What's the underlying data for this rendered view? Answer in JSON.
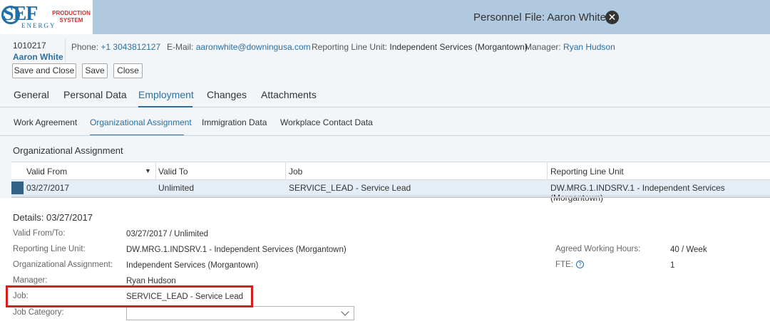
{
  "logo": {
    "name": "SEF",
    "sub": "ENERGY",
    "system": "PRODUCTION SYSTEM"
  },
  "window": {
    "title": "Personnel File: Aaron White"
  },
  "employee": {
    "id": "1010217",
    "name": "Aaron White",
    "phone_label": "Phone:",
    "phone": "+1 3043812127",
    "email_label": "E-Mail:",
    "email": "aaronwhite@downingusa.com",
    "rlu_label": "Reporting Line Unit:",
    "rlu": "Independent Services (Morgantown)",
    "manager_label": "Manager:",
    "manager": "Ryan Hudson"
  },
  "actions": {
    "save_close": "Save and Close",
    "save": "Save",
    "close": "Close"
  },
  "tabs": [
    "General",
    "Personal Data",
    "Employment",
    "Changes",
    "Attachments"
  ],
  "active_tab": "Employment",
  "subtabs": [
    "Work Agreement",
    "Organizational Assignment",
    "Immigration Data",
    "Workplace Contact Data"
  ],
  "active_subtab": "Organizational Assignment",
  "section": {
    "title": "Organizational Assignment",
    "columns": [
      "Valid From",
      "Valid To",
      "Job",
      "Reporting Line Unit"
    ],
    "rows": [
      [
        "03/27/2017",
        "Unlimited",
        "SERVICE_LEAD - Service Lead",
        "DW.MRG.1.INDSRV.1 - Independent Services (Morgantown)"
      ]
    ]
  },
  "details": {
    "title": "Details: 03/27/2017",
    "valid_label": "Valid From/To:",
    "valid": "03/27/2017 / Unlimited",
    "rlu_label": "Reporting Line Unit:",
    "rlu": "DW.MRG.1.INDSRV.1 - Independent Services (Morgantown)",
    "org_label": "Organizational Assignment:",
    "org": "Independent Services (Morgantown)",
    "manager_label": "Manager:",
    "manager": "Ryan Hudson",
    "job_label": "Job:",
    "job": "SERVICE_LEAD - Service Lead",
    "job_category_label": "Job Category:",
    "job_category": "",
    "hours_label": "Agreed Working Hours:",
    "hours": "40 / Week",
    "fte_label": "FTE:",
    "fte": "1"
  },
  "colors": {
    "accent": "#2b6fa1",
    "topbar": "#b0c9de",
    "highlight": "#d62020"
  }
}
